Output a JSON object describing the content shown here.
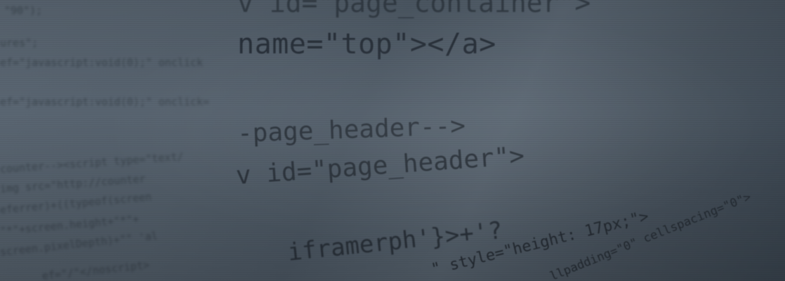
{
  "scene": {
    "code_lines": {
      "top_partial": "v id=\"page_container\">",
      "anchor_line": "name=\"top\"></a>",
      "comment_line": "-page_header-->",
      "div_line": "v id=\"page_header\">",
      "script_fragment": "iframerph'}>+'?",
      "style_fragment": "\" style=\"height: 17px;\">",
      "table_fragment": "llpadding=\"0\" cellspacing=\"0\">"
    },
    "blurred_left_lines": [
      "\"90\");",
      "ures\";",
      "ef=\"javascript:void(0);\" onclick",
      "ef=\"javascript:void(0);\" onclick=",
      "counter--><script type=\"text/",
      "img src=\"http://counter",
      "eferrer)+((typeof(screen",
      "\"*\"+screen.height+\"*\"+",
      "screen.pixelDepth)+\"\" 'al",
      "ef=\"/\"</noscript>"
    ]
  }
}
